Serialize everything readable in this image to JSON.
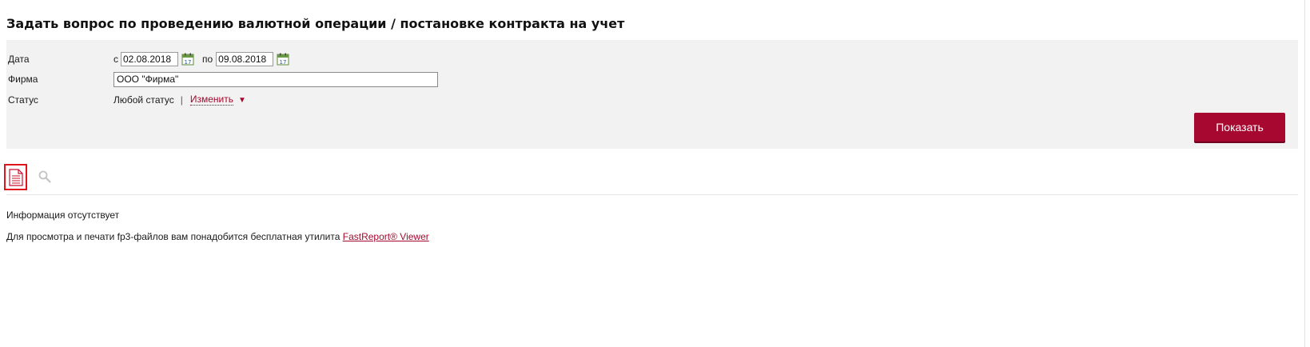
{
  "page": {
    "title": "Задать вопрос по проведению валютной операции / постановке контракта на учет"
  },
  "filter": {
    "date": {
      "label": "Дата",
      "from_prefix": "с",
      "from_value": "02.08.2018",
      "to_prefix": "по",
      "to_value": "09.08.2018",
      "calendar_day": "17"
    },
    "firm": {
      "label": "Фирма",
      "value": "ООО \"Фирма\""
    },
    "status": {
      "label": "Статус",
      "value": "Любой статус",
      "separator": "|",
      "change_label": "Изменить",
      "caret": "▼"
    },
    "show_button": "Показать"
  },
  "toolbar": {
    "document_icon": "document-icon",
    "search_icon": "search-icon"
  },
  "content": {
    "empty_text": "Информация отсутствует",
    "note_text": "Для просмотра и печати fp3-файлов вам понадобится бесплатная утилита ",
    "note_link": "FastReport® Viewer"
  },
  "colors": {
    "accent": "#a7082f",
    "panel_bg": "#f2f2f2",
    "highlight_border": "#e1141b"
  }
}
